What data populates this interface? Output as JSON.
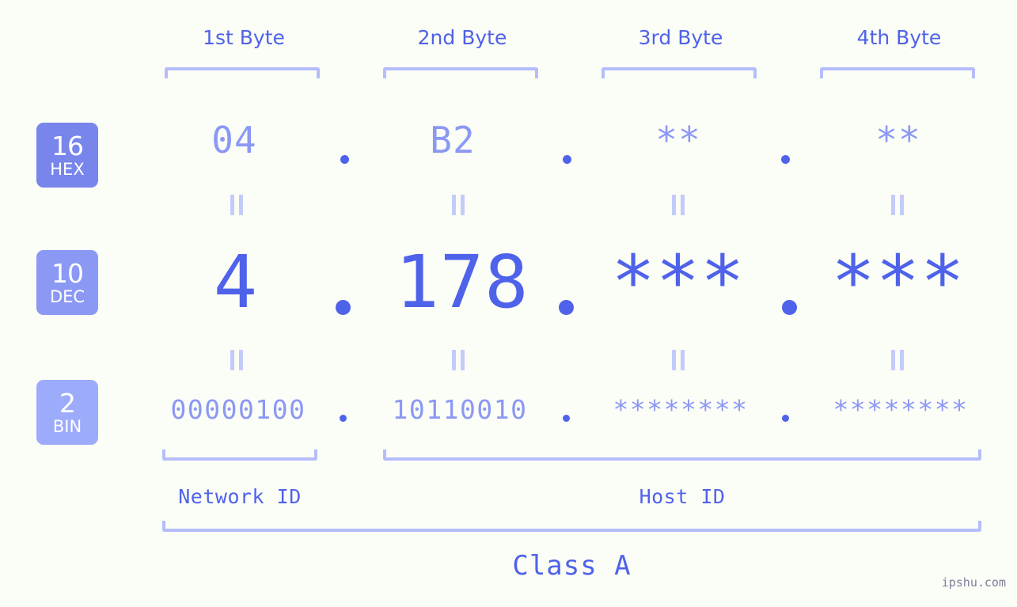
{
  "page": {
    "background_color": "#fbfdf7",
    "accent_color": "#4f62ea",
    "accent_light_color": "#8b98f4",
    "bracket_color": "#b5bdfa",
    "watermark": "ipshu.com"
  },
  "byte_headers": [
    {
      "label": "1st Byte"
    },
    {
      "label": "2nd Byte"
    },
    {
      "label": "3rd Byte"
    },
    {
      "label": "4th Byte"
    }
  ],
  "bases": [
    {
      "num": "16",
      "name": "HEX",
      "color": "#7886ec"
    },
    {
      "num": "10",
      "name": "DEC",
      "color": "#8b98f4"
    },
    {
      "num": "2",
      "name": "BIN",
      "color": "#9cabfa"
    }
  ],
  "rows": {
    "hex": {
      "base_label": "16",
      "base_name": "HEX",
      "values": [
        "04",
        "B2",
        "**",
        "**"
      ],
      "separator": "."
    },
    "dec": {
      "base_label": "10",
      "base_name": "DEC",
      "values": [
        "4",
        "178",
        "***",
        "***"
      ],
      "separator": "."
    },
    "bin": {
      "base_label": "2",
      "base_name": "BIN",
      "values": [
        "00000100",
        "10110010",
        "********",
        "********"
      ],
      "separator": "."
    }
  },
  "equals_symbol": "=",
  "segments": [
    {
      "label": "Network ID"
    },
    {
      "label": "Host ID"
    }
  ],
  "class": {
    "label": "Class A"
  }
}
